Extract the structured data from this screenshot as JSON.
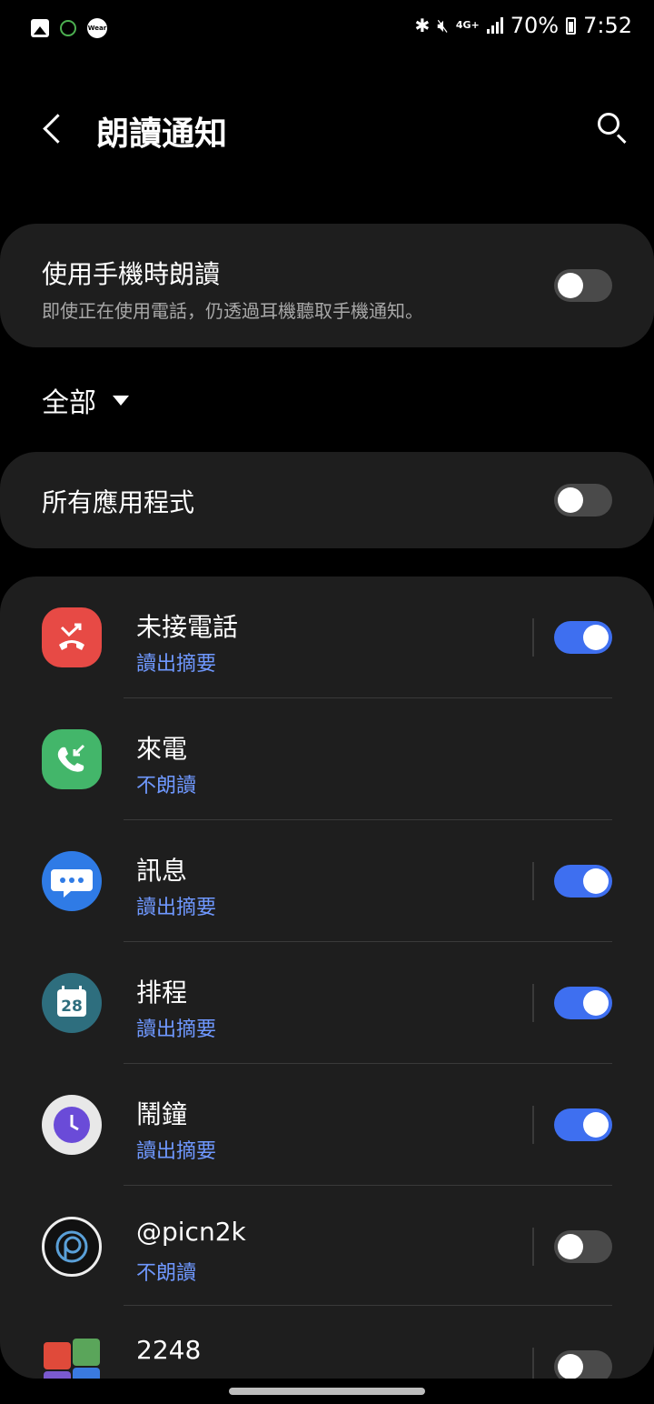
{
  "status_bar": {
    "battery_text": "70%",
    "time": "7:52",
    "network_label": "4G+",
    "left_icons": [
      "gallery-icon",
      "face-icon",
      "wear-icon"
    ],
    "right_icons": [
      "bluetooth-icon",
      "mute-icon",
      "network-icon",
      "signal-icon",
      "battery-icon"
    ],
    "wear_label": "Wear"
  },
  "header": {
    "title": "朗讀通知"
  },
  "read_while_using": {
    "title": "使用手機時朗讀",
    "subtitle": "即使正在使用電話，仍透過耳機聽取手機通知。",
    "enabled": false
  },
  "filter": {
    "label": "全部"
  },
  "all_apps": {
    "label": "所有應用程式",
    "enabled": false
  },
  "apps": [
    {
      "name": "未接電話",
      "status": "讀出摘要",
      "toggle": true,
      "enabled": true,
      "icon": "missed-call-icon"
    },
    {
      "name": "來電",
      "status": "不朗讀",
      "toggle": false,
      "enabled": false,
      "icon": "incoming-call-icon"
    },
    {
      "name": "訊息",
      "status": "讀出摘要",
      "toggle": true,
      "enabled": true,
      "icon": "messages-icon"
    },
    {
      "name": "排程",
      "status": "讀出摘要",
      "toggle": true,
      "enabled": true,
      "icon": "calendar-icon",
      "icon_text": "28"
    },
    {
      "name": "鬧鐘",
      "status": "讀出摘要",
      "toggle": true,
      "enabled": true,
      "icon": "clock-icon"
    },
    {
      "name": "@picn2k",
      "status": "不朗讀",
      "toggle": true,
      "enabled": false,
      "icon": "picn2k-icon"
    },
    {
      "name": "2248",
      "status": "",
      "toggle": true,
      "enabled": false,
      "icon": "game-2248-icon"
    }
  ],
  "colors": {
    "background": "#000000",
    "card": "#1e1e1e",
    "accent": "#3e6ff0",
    "status_link": "#6f98ff"
  }
}
